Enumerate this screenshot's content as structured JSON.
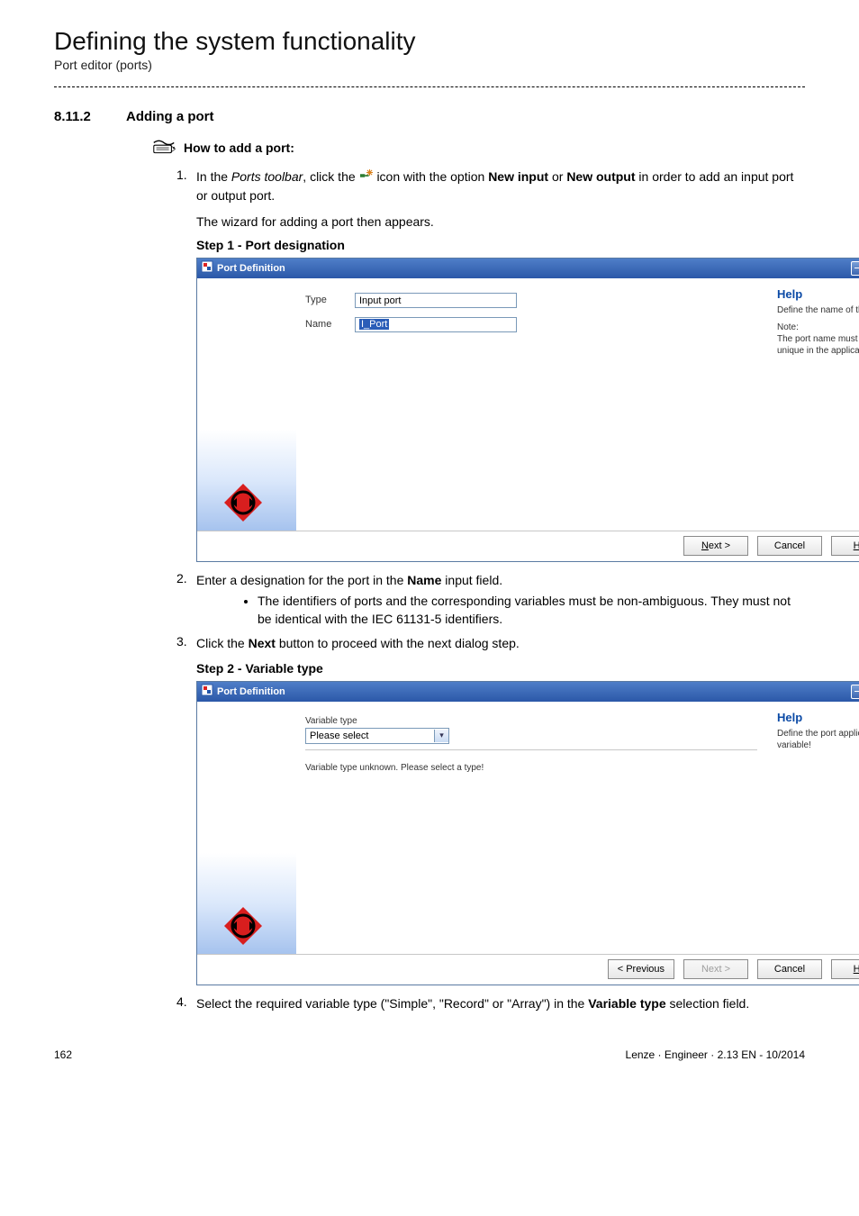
{
  "heading": "Defining the system functionality",
  "subheading": "Port editor (ports)",
  "section_number": "8.11.2",
  "section_title": "Adding a port",
  "howto_icon": "steps-icon",
  "howto_label": "How to add a port:",
  "step1_num": "1.",
  "step1_a": "In the ",
  "step1_b": "Ports toolbar",
  "step1_c": ", click the ",
  "step1_d": " icon with the option ",
  "step1_e": "New input",
  "step1_f": " or ",
  "step1_g": "New output",
  "step1_h": " in order to add an input port or output port.",
  "step1_para": "The wizard for adding a port then appears.",
  "step1_sub_title": "Step 1 - Port designation",
  "dlg1": {
    "title": "Port Definition",
    "type_label": "Type",
    "type_value": "Input port",
    "name_label": "Name",
    "name_value": "I_Port",
    "help_h": "Help",
    "help_t1": "Define the name of the port!",
    "help_note_h": "Note:",
    "help_note_t": "The port name must be unique in the application!",
    "btn_next": "Next >",
    "btn_next_u": "N",
    "btn_cancel": "Cancel",
    "btn_help": "Help",
    "btn_help_u": "H"
  },
  "step2_num": "2.",
  "step2_text": "Enter a designation for the port in the ",
  "step2_bold": "Name",
  "step2_text2": " input field.",
  "step2_bullet": "The identifiers of ports and the corresponding variables must be non-ambiguous. They must not be identical with the IEC 61131-5 identifiers.",
  "step3_num": "3.",
  "step3_text": "Click the ",
  "step3_bold": "Next",
  "step3_text2": " button to proceed with the next dialog step.",
  "step3_sub_title": "Step 2 - Variable type",
  "dlg2": {
    "title": "Port Definition",
    "vartype_group": "Variable type",
    "vartype_value": "Please select",
    "note": "Variable type unknown. Please select a type!",
    "help_h": "Help",
    "help_t1": "Define the port application variable!",
    "btn_prev": "< Previous",
    "btn_next": "Next >",
    "btn_cancel": "Cancel",
    "btn_help": "Help",
    "btn_help_u": "H"
  },
  "step4_num": "4.",
  "step4_text_a": "Select the required variable type (\"Simple\", \"Record\" or \"Array\") in the ",
  "step4_bold": "Variable type",
  "step4_text_b": " selection field.",
  "page_num": "162",
  "footer_right": "Lenze · Engineer · 2.13 EN - 10/2014"
}
